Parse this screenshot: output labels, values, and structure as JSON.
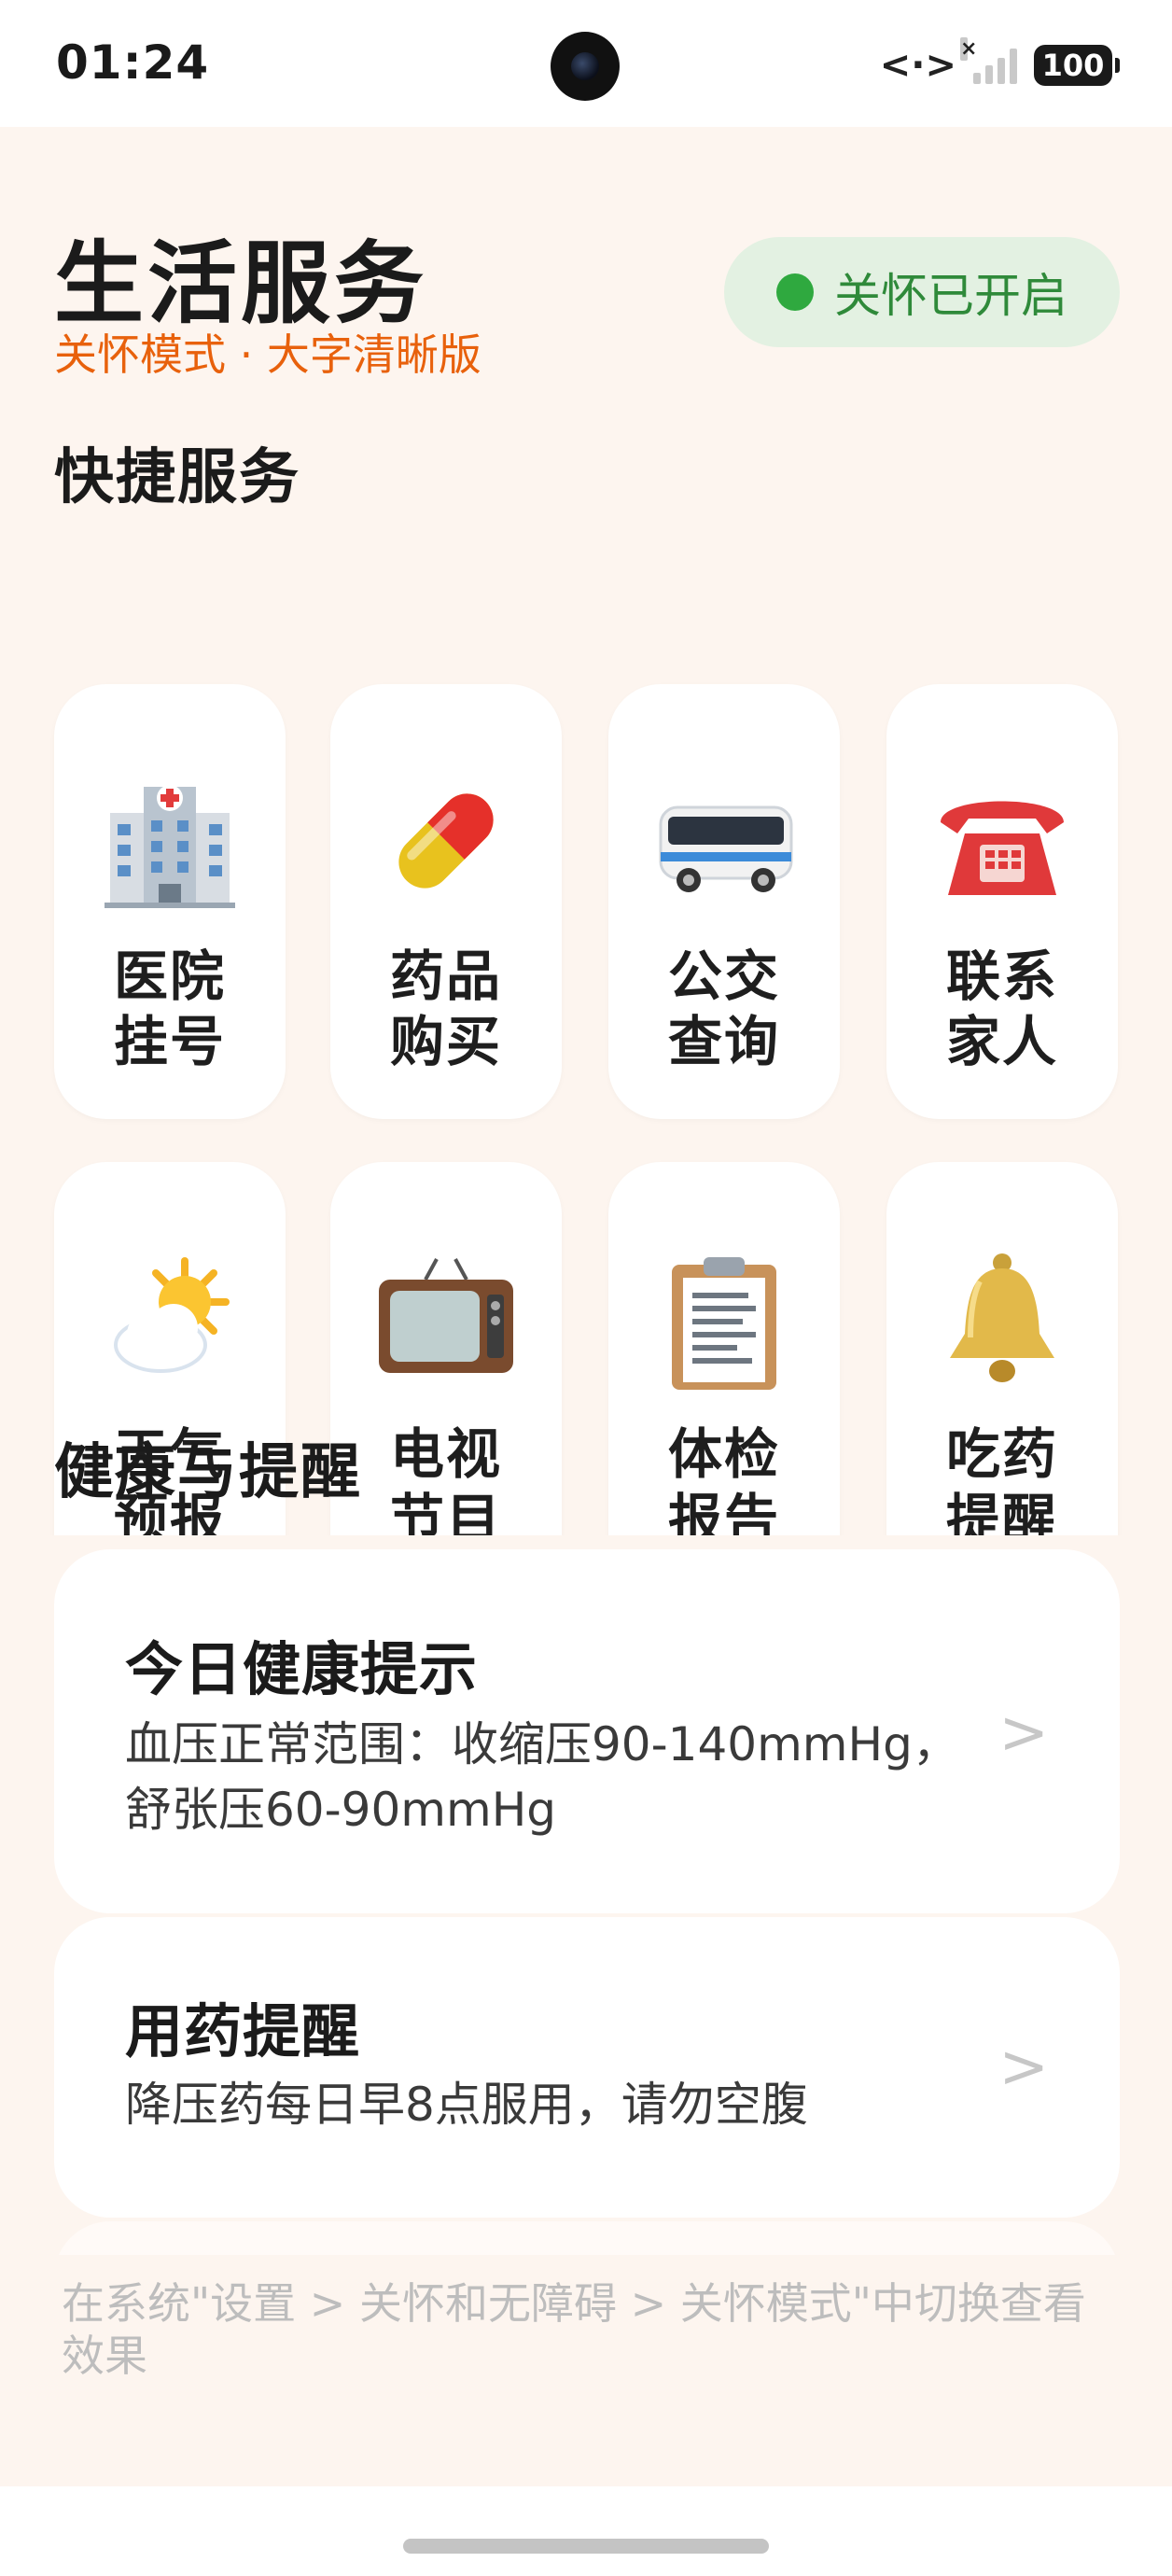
{
  "status_bar": {
    "time": "01:24",
    "signal_x": "×",
    "battery": "100"
  },
  "header": {
    "title": "生活服务",
    "subtitle": "关怀模式 · 大字清晰版",
    "care_status": "关怀已开启"
  },
  "quick_services": {
    "title": "快捷服务",
    "items": [
      {
        "label": "医院\n挂号",
        "icon": "hospital-icon"
      },
      {
        "label": "药品\n购买",
        "icon": "pill-icon"
      },
      {
        "label": "公交\n查询",
        "icon": "bus-icon"
      },
      {
        "label": "联系\n家人",
        "icon": "telephone-icon"
      },
      {
        "label": "天气\n预报",
        "icon": "weather-icon"
      },
      {
        "label": "电视\n节目",
        "icon": "tv-icon"
      },
      {
        "label": "体检\n报告",
        "icon": "clipboard-icon"
      },
      {
        "label": "吃药\n提醒",
        "icon": "bell-icon"
      }
    ]
  },
  "health": {
    "title": "健康与提醒",
    "cards": [
      {
        "title": "今日健康提示",
        "desc": "血压正常范围：收缩压90-140mmHg，舒张压60-90mmHg",
        "arrow": ">"
      },
      {
        "title": "用药提醒",
        "desc": "降压药每日早8点服用，请勿空腹",
        "arrow": ">"
      }
    ]
  },
  "footer": {
    "note": "在系统\"设置 > 关怀和无障碍 > 关怀模式\"中切换查看效果"
  },
  "colors": {
    "accent": "#e8610c",
    "care_green": "#2fa93f",
    "page_bg": "#fdf5ef"
  }
}
